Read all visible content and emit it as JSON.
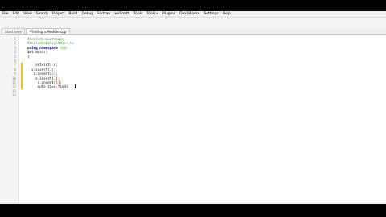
{
  "menu": [
    "File",
    "Edit",
    "View",
    "Search",
    "Project",
    "Build",
    "Debug",
    "Fortran",
    "wxSmith",
    "Tools",
    "Tools+",
    "Plugins",
    "DoxyBlocks",
    "Settings",
    "Help"
  ],
  "tabs": [
    {
      "label": "Start here",
      "active": false
    },
    {
      "label": "*Finding a.Module.cpp",
      "active": true
    }
  ],
  "code": {
    "lines": [
      {
        "n": "1",
        "parts": [
          {
            "c": "pp",
            "t": "#include<iostream>"
          }
        ]
      },
      {
        "n": "2",
        "parts": [
          {
            "c": "pp",
            "t": "#include<bits/stdc++.h>"
          }
        ]
      },
      {
        "n": "3",
        "parts": [
          {
            "c": "kw",
            "t": "using namespace "
          },
          {
            "c": "pp",
            "t": "std;"
          }
        ]
      },
      {
        "n": "4",
        "parts": [
          {
            "c": "kw",
            "t": "int "
          },
          {
            "c": "ident",
            "t": "main()"
          }
        ]
      },
      {
        "n": "5",
        "parts": [
          {
            "c": "punct",
            "t": "{"
          }
        ]
      },
      {
        "n": "6",
        "parts": []
      },
      {
        "n": "7",
        "parts": [
          {
            "c": "ident",
            "t": "    set<int> s;"
          }
        ]
      },
      {
        "n": "8",
        "parts": [
          {
            "c": "ident",
            "t": "  s.insert("
          },
          {
            "c": "num",
            "t": "1"
          },
          {
            "c": "punct",
            "t": ");"
          }
        ]
      },
      {
        "n": "9",
        "parts": [
          {
            "c": "ident",
            "t": "   s.insert("
          },
          {
            "c": "num",
            "t": "2"
          },
          {
            "c": "punct",
            "t": ");"
          }
        ]
      },
      {
        "n": "10",
        "parts": [
          {
            "c": "ident",
            "t": "    s.insert("
          },
          {
            "c": "num",
            "t": "3"
          },
          {
            "c": "punct",
            "t": ");"
          }
        ]
      },
      {
        "n": "11",
        "parts": [
          {
            "c": "ident",
            "t": "     s.insert("
          },
          {
            "c": "num",
            "t": "4"
          },
          {
            "c": "punct",
            "t": ");"
          }
        ]
      },
      {
        "n": "12",
        "parts": [
          {
            "c": "ident",
            "t": "     auto it=s.find("
          },
          {
            "c": "punct",
            "t": ""
          }
        ]
      },
      {
        "n": "13",
        "parts": []
      },
      {
        "n": "14",
        "parts": []
      }
    ]
  },
  "colors": {
    "preprocessor": "#2ca02c",
    "keyword": "#00008b",
    "number": "#d65c00",
    "change_marker": "#f0c419"
  }
}
